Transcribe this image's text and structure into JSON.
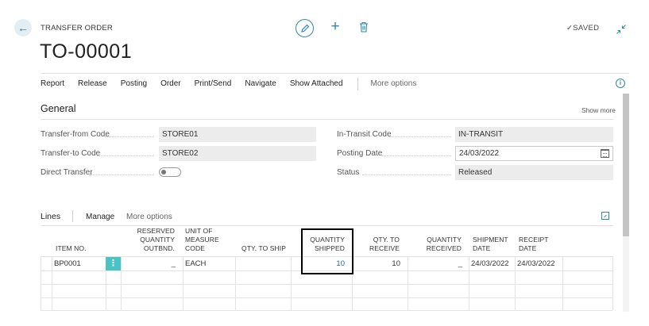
{
  "header": {
    "caption": "TRANSFER ORDER",
    "title": "TO-00001",
    "saved_label": "SAVED"
  },
  "actions": [
    "Report",
    "Release",
    "Posting",
    "Order",
    "Print/Send",
    "Navigate",
    "Show Attached"
  ],
  "more_options": "More options",
  "general": {
    "title": "General",
    "show_more": "Show more",
    "transfer_from_label": "Transfer-from Code",
    "transfer_from_value": "STORE01",
    "transfer_to_label": "Transfer-to Code",
    "transfer_to_value": "STORE02",
    "direct_transfer_label": "Direct Transfer",
    "in_transit_label": "In-Transit Code",
    "in_transit_value": "IN-TRANSIT",
    "posting_date_label": "Posting Date",
    "posting_date_value": "24/03/2022",
    "status_label": "Status",
    "status_value": "Released"
  },
  "lines": {
    "title": "Lines",
    "manage": "Manage",
    "more_options": "More options",
    "columns": {
      "item_no": "ITEM NO.",
      "reserved": [
        "RESERVED",
        "QUANTITY",
        "OUTBND."
      ],
      "uom": [
        "UNIT OF",
        "MEASURE",
        "CODE"
      ],
      "qty_to_ship": "QTY. TO SHIP",
      "qty_shipped": [
        "QUANTITY",
        "SHIPPED"
      ],
      "qty_to_receive": [
        "QTY. TO",
        "RECEIVE"
      ],
      "qty_received": [
        "QUANTITY",
        "RECEIVED"
      ],
      "shipment_date": [
        "SHIPMENT",
        "DATE"
      ],
      "receipt_date": [
        "RECEIPT",
        "DATE"
      ]
    },
    "rows": [
      {
        "item_no": "BP0001",
        "reserved": "_",
        "uom": "EACH",
        "qty_to_ship": "",
        "qty_shipped": "10",
        "qty_to_receive": "10",
        "qty_received": "_",
        "shipment_date": "24/03/2022",
        "receipt_date": "24/03/2022"
      }
    ]
  },
  "colors": {
    "accent": "#2f8aa8",
    "row_action": "#4bc2c6"
  }
}
